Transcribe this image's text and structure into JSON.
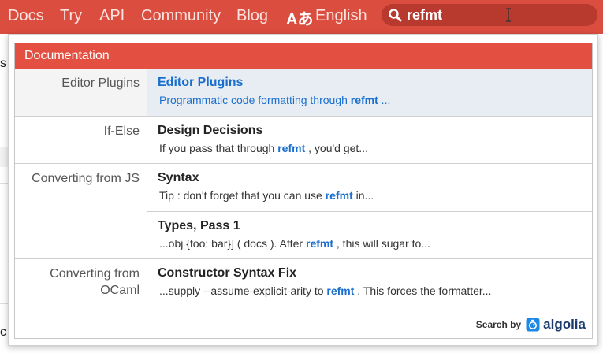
{
  "nav": {
    "links": [
      "Docs",
      "Try",
      "API",
      "Community",
      "Blog"
    ],
    "language_icon": "Aあ",
    "language": "English"
  },
  "search": {
    "value": "refmt",
    "placeholder": ""
  },
  "background_text": {
    "s": "s",
    "c": "c"
  },
  "dropdown": {
    "category": "Documentation",
    "rows": [
      {
        "subcategory": "Editor Plugins",
        "title": "Editor Plugins",
        "snippet_before": "Programmatic code formatting through ",
        "snippet_hl": "refmt",
        "snippet_after": " ..."
      },
      {
        "subcategory": "If-Else",
        "title": "Design Decisions",
        "snippet_before": "If you pass that through ",
        "snippet_hl": "refmt",
        "snippet_after": " , you'd get..."
      },
      {
        "subcategory": "Converting from JS",
        "title": "Syntax",
        "snippet_before": "Tip : don't forget that you can use ",
        "snippet_hl": "refmt",
        "snippet_after": " in..."
      },
      {
        "subcategory": "",
        "title": "Types, Pass 1",
        "snippet_before": "...obj {foo: bar}] ( docs ). After ",
        "snippet_hl": "refmt",
        "snippet_after": " , this will sugar to..."
      },
      {
        "subcategory": "Converting from OCaml",
        "title": "Constructor Syntax Fix",
        "snippet_before": "...supply --assume-explicit-arity to ",
        "snippet_hl": "refmt",
        "snippet_after": " . This forces the formatter..."
      }
    ],
    "footer_label": "Search by",
    "footer_brand": "algolia"
  },
  "colors": {
    "navbar": "#db4d3f",
    "category_header": "#e35042",
    "highlight": "#1a6fce",
    "active_row": "#e8edf3"
  }
}
